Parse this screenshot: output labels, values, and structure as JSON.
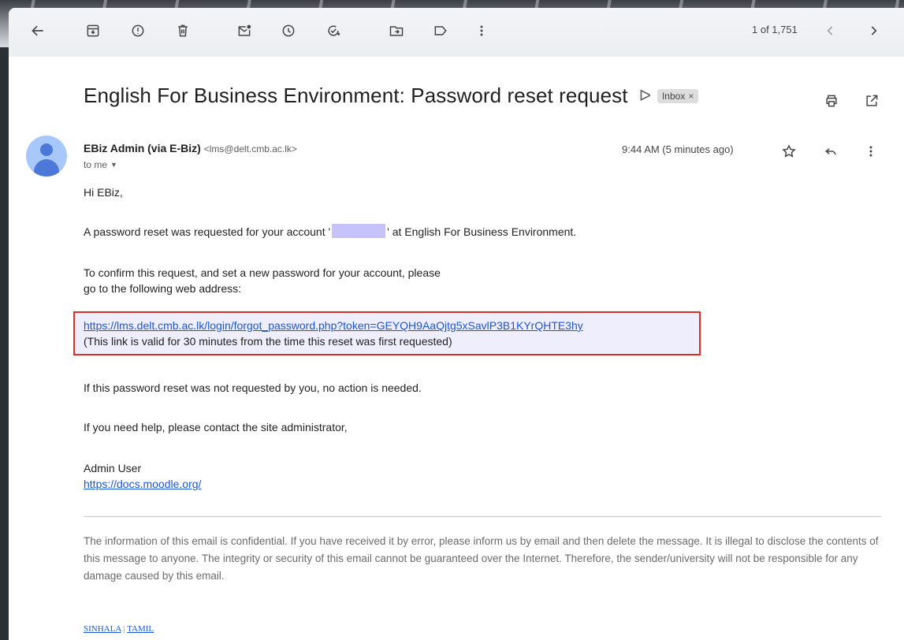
{
  "toolbar": {
    "pager": "1 of 1,751"
  },
  "email": {
    "subject": "English For Business Environment: Password reset request",
    "label_chip": "Inbox",
    "label_chip_close": "×",
    "sender_name": "EBiz Admin (via E-Biz)",
    "sender_email": "<lms@delt.cmb.ac.lk>",
    "to": "to me",
    "timestamp": "9:44 AM (5 minutes ago)",
    "greeting": "Hi EBiz,",
    "para1_before": "A password reset was requested for your account '",
    "para1_after": "' at English For Business Environment.",
    "para2_line1": "To confirm this request, and set a new password for your account, please",
    "para2_line2": "go to the following web address:",
    "reset_link": "https://lms.delt.cmb.ac.lk/login/forgot_password.php?token=GEYQH9AaQjtg5xSavlP3B1KYrQHTE3hy",
    "link_validity": "(This link is valid for 30 minutes from the time this reset was first requested)",
    "para3": "If this password reset was not requested by you, no action is needed.",
    "para4": "If you need help, please contact the site administrator,",
    "signature_name": "Admin User",
    "signature_link": "https://docs.moodle.org/",
    "disclaimer": "The information of this email is confidential. If you have received it by error, please inform us by email and then delete the message. It is illegal to disclose the contents of this message to anyone. The integrity or security of this email cannot be guaranteed over the Internet.  Therefore, the sender/university will not be responsible for any damage caused by this email.",
    "lang_sinhala": "SINHALA",
    "lang_sep": "|",
    "lang_tamil": "TAMIL"
  },
  "colors": {
    "highlight_border": "#d93025",
    "highlight_bg": "#eeeefc",
    "link": "#1a57d8",
    "avatar_bg": "#a8c7fa"
  }
}
